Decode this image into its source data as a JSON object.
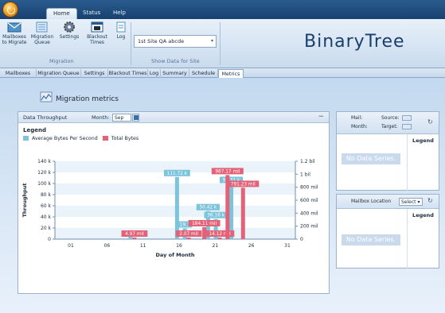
{
  "window": {
    "tabs": [
      {
        "label": "Home",
        "active": true
      },
      {
        "label": "Status",
        "active": false
      },
      {
        "label": "Help",
        "active": false
      }
    ],
    "logo_text": "BinaryTree"
  },
  "ribbon": {
    "buttons": [
      {
        "label": "Mailboxes to Migrate",
        "icon": "mailboxes-icon"
      },
      {
        "label": "Migration Queue",
        "icon": "queue-icon"
      },
      {
        "label": "Settings",
        "icon": "gear-icon"
      },
      {
        "label": "Blackout Times",
        "icon": "calendar-icon"
      },
      {
        "label": "Log",
        "icon": "log-icon"
      }
    ],
    "group_migration": "Migration",
    "site_select_value": "1st Site QA abcde",
    "group_site": "Show Data for Site"
  },
  "view_tabs": [
    "Mailboxes",
    "Migration Queue",
    "Settings",
    "Blackout Times",
    "Log",
    "Summary",
    "Schedule",
    "Metrics"
  ],
  "active_view_tab": "Metrics",
  "page": {
    "title": "Migration metrics"
  },
  "chart_panel": {
    "header_title": "Data Throughput",
    "month_label": "Month:",
    "month_value": "Sep",
    "legend_title": "Legend",
    "legend_items": [
      {
        "label": "Average Bytes Per Second",
        "color": "#7cc3dc"
      },
      {
        "label": "Total Bytes",
        "color": "#e46277"
      }
    ]
  },
  "chart_data": {
    "type": "bar",
    "xlabel": "Day of Month",
    "ylabel": "Throughput",
    "y_left_ticks": [
      "0",
      "20 k",
      "40 k",
      "60 k",
      "80 k",
      "100 k",
      "120 k",
      "140 k"
    ],
    "y_left_lim": [
      0,
      140000
    ],
    "y_right_ticks": [
      "0",
      "200 mil",
      "400 mil",
      "600 mil",
      "800 mil",
      "1 bil",
      "1.2 bil"
    ],
    "y_right_lim": [
      0,
      1200000000
    ],
    "x_ticks": [
      "01",
      "06",
      "11",
      "16",
      "21",
      "26",
      "31"
    ],
    "x_lim": [
      0,
      31
    ],
    "grid": true,
    "series": [
      {
        "name": "Average Bytes Per Second",
        "color": "#7cc3dc",
        "axis": "left",
        "points": [
          {
            "day": 10,
            "value": 11000,
            "label": ""
          },
          {
            "day": 16,
            "value": 111720,
            "label": "111.72 k"
          },
          {
            "day": 17,
            "value": 19300,
            "label": "19.3"
          },
          {
            "day": 20,
            "value": 50420,
            "label": "50.42 k"
          },
          {
            "day": 21,
            "value": 36160,
            "label": "36.16 k"
          },
          {
            "day": 23,
            "value": 99310,
            "label": "99.31 k"
          }
        ]
      },
      {
        "name": "Total Bytes",
        "color": "#e46277",
        "axis": "right",
        "points": [
          {
            "day": 10,
            "value": 4970000,
            "label": "4.97 mil"
          },
          {
            "day": 17,
            "value": 2070000,
            "label": "2.07 mil"
          },
          {
            "day": 19,
            "value": 184110000,
            "label": "184.11 mil"
          },
          {
            "day": 21,
            "value": 14120000,
            "label": "14.12 mil"
          },
          {
            "day": 22,
            "value": 987170000,
            "label": "987.17 mil"
          },
          {
            "day": 24,
            "value": 791230000,
            "label": "791.23 mil"
          }
        ]
      }
    ]
  },
  "side_top": {
    "mail_label": "Mail:",
    "month_label": "Month:",
    "source_label": "Source:",
    "target_label": "Target:",
    "legend_title": "Legend",
    "no_data": "No Data Series."
  },
  "side_bottom": {
    "title": "Mailbox Location",
    "select_value": "Select",
    "legend_title": "Legend",
    "no_data": "No Data Series."
  }
}
